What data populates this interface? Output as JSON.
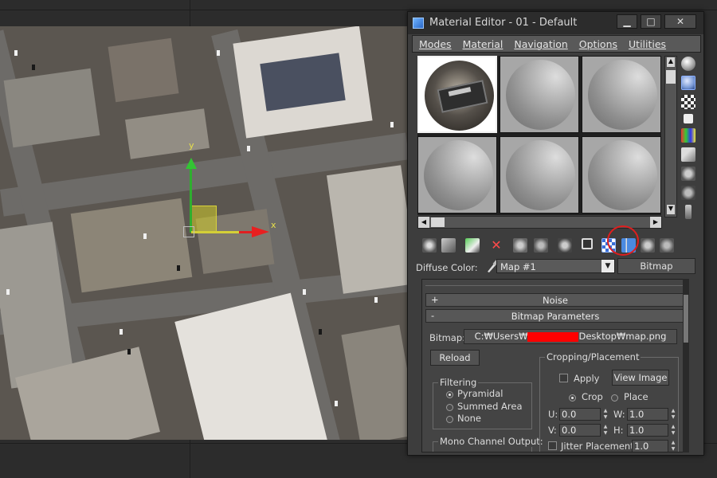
{
  "viewport": {
    "axis_y": "y",
    "axis_x": "x"
  },
  "window": {
    "title": "Material Editor - 01 - Default",
    "controls": {
      "minimize": "▁",
      "maximize": "□",
      "close": "✕"
    }
  },
  "menu": [
    "Modes",
    "Material",
    "Navigation",
    "Options",
    "Utilities"
  ],
  "diffuse": {
    "label": "Diffuse Color:",
    "map_value": "Map #1",
    "type_button": "Bitmap"
  },
  "rollouts": {
    "noise": {
      "sign": "+",
      "title": "Noise"
    },
    "bitmap_params": {
      "sign": "-",
      "title": "Bitmap Parameters"
    }
  },
  "bitmap": {
    "label": "Bitmap:",
    "path_prefix": "C:₩Users₩",
    "path_suffix": "Desktop₩map.png",
    "reload": "Reload"
  },
  "filtering": {
    "title": "Filtering",
    "options": [
      "Pyramidal",
      "Summed Area",
      "None"
    ],
    "selected": "Pyramidal"
  },
  "mono": {
    "title": "Mono Channel Output:"
  },
  "cropping": {
    "title": "Cropping/Placement",
    "apply": "Apply",
    "view_image": "View Image",
    "crop": "Crop",
    "place": "Place",
    "u_label": "U:",
    "u_value": "0.0",
    "w_label": "W:",
    "w_value": "1.0",
    "v_label": "V:",
    "v_value": "0.0",
    "h_label": "H:",
    "h_value": "1.0",
    "jitter": "Jitter Placement:",
    "jitter_value": "1.0"
  },
  "colors": {
    "window_bg": "#3d3d3d",
    "titlebar": "#2c2c2c",
    "highlight_circle": "#e01e1e",
    "gizmo_y": "#33c433",
    "gizmo_x": "#e82020"
  }
}
